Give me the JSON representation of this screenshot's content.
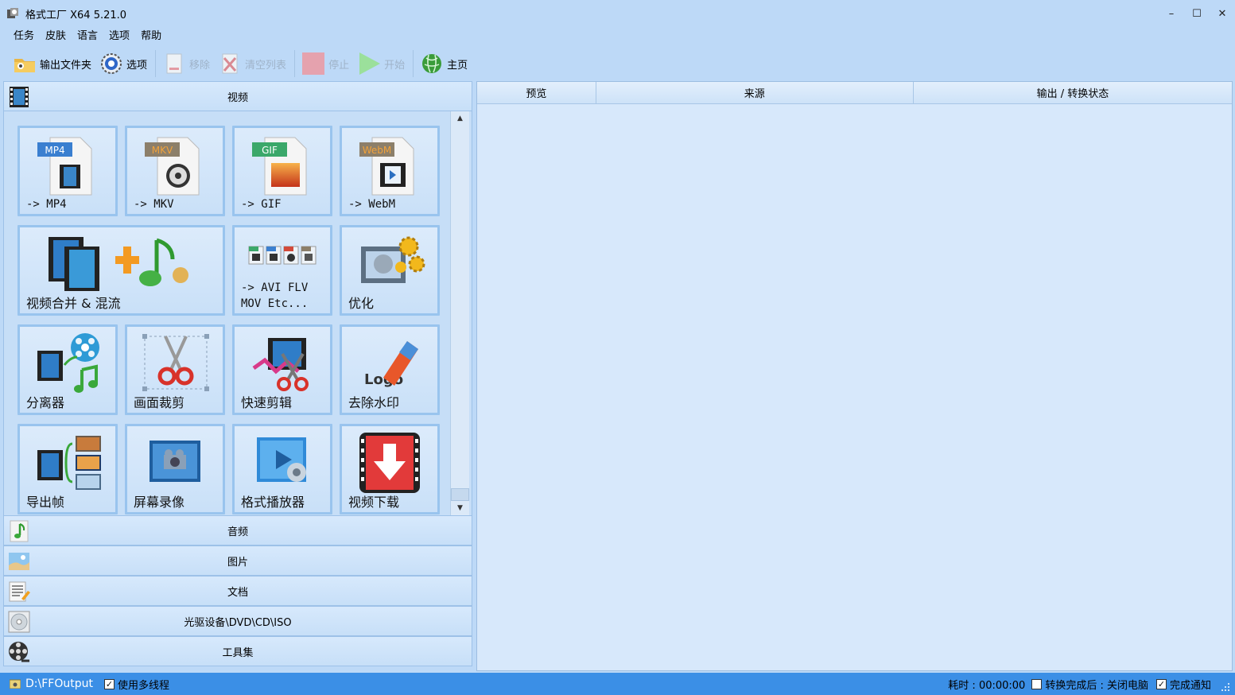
{
  "window": {
    "title": "格式工厂 X64 5.21.0"
  },
  "menu": [
    "任务",
    "皮肤",
    "语言",
    "选项",
    "帮助"
  ],
  "toolbar": {
    "output_folder": "输出文件夹",
    "options": "选项",
    "remove": "移除",
    "clear_list": "清空列表",
    "stop": "停止",
    "start": "开始",
    "home": "主页"
  },
  "categories": {
    "video": "视频",
    "audio": "音频",
    "image": "图片",
    "document": "文档",
    "disc": "光驱设备\\DVD\\CD\\ISO",
    "tools": "工具集"
  },
  "video_tiles": {
    "mp4": "-> MP4",
    "mkv": "-> MKV",
    "gif": "-> GIF",
    "webm": "-> WebM",
    "merge": "视频合并 & 混流",
    "avi": "-> AVI FLV\nMOV Etc...",
    "optimize": "优化",
    "splitter": "分离器",
    "crop": "画面裁剪",
    "quick_cut": "快速剪辑",
    "watermark": "去除水印",
    "export_frames": "导出帧",
    "screen_record": "屏幕录像",
    "player": "格式播放器",
    "download": "视频下载"
  },
  "file_badges": {
    "mp4": "MP4",
    "mkv": "MKV",
    "gif": "GIF",
    "webm": "WebM",
    "logo": "Logo"
  },
  "grid": {
    "columns": [
      "预览",
      "来源",
      "输出 / 转换状态"
    ]
  },
  "status": {
    "output_path": "D:\\FFOutput",
    "multithread": "使用多线程",
    "elapsed": "耗时 : 00:00:00",
    "after_convert": "转换完成后 : 关闭电脑",
    "notify": "完成通知"
  },
  "colors": {
    "accent": "#3b8fe6",
    "panel": "#c6def7",
    "tile_border": "#99c4ee"
  }
}
